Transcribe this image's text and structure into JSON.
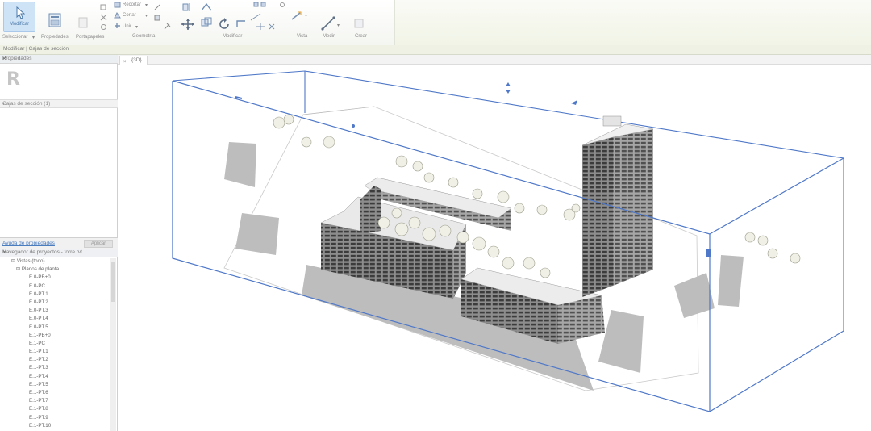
{
  "ribbon": {
    "modify_label": "Modificar",
    "select_label": "Seleccionar",
    "properties_label": "Propiedades",
    "clipboard_label": "Portapapeles",
    "cut_label": "Recortar",
    "cope_label": "Cortar",
    "join_label": "Unir",
    "groups": {
      "geometry": "Geometría",
      "modify": "Modificar",
      "view": "Vista",
      "measure": "Medir",
      "create": "Crear"
    }
  },
  "context": {
    "status_text": "Modificar | Cajas de sección"
  },
  "properties": {
    "title": "Propiedades",
    "type_selector": "Cajas de sección (1)",
    "help_link": "Ayuda de propiedades",
    "apply_label": "Aplicar"
  },
  "browser": {
    "title": "Navegador de proyectos - torre.rvt",
    "root": "Vistas (todo)",
    "group": "Planos de planta",
    "items": [
      "E.0-PB+0",
      "E.0-PC",
      "E.0-PT.1",
      "E.0-PT.2",
      "E.0-PT.3",
      "E.0-PT.4",
      "E.0-PT.5",
      "E.1-PB+0",
      "E.1-PC",
      "E.1-PT.1",
      "E.1-PT.2",
      "E.1-PT.3",
      "E.1-PT.4",
      "E.1-PT.5",
      "E.1-PT.6",
      "E.1-PT.7",
      "E.1-PT.8",
      "E.1-PT.9",
      "E.1-PT.10"
    ]
  },
  "view": {
    "tab_label": "{3D}"
  },
  "colors": {
    "section_box": "#4f78c8",
    "selection_fill": "#cfe3f7",
    "ribbon_bg": "#f1f4e6"
  }
}
